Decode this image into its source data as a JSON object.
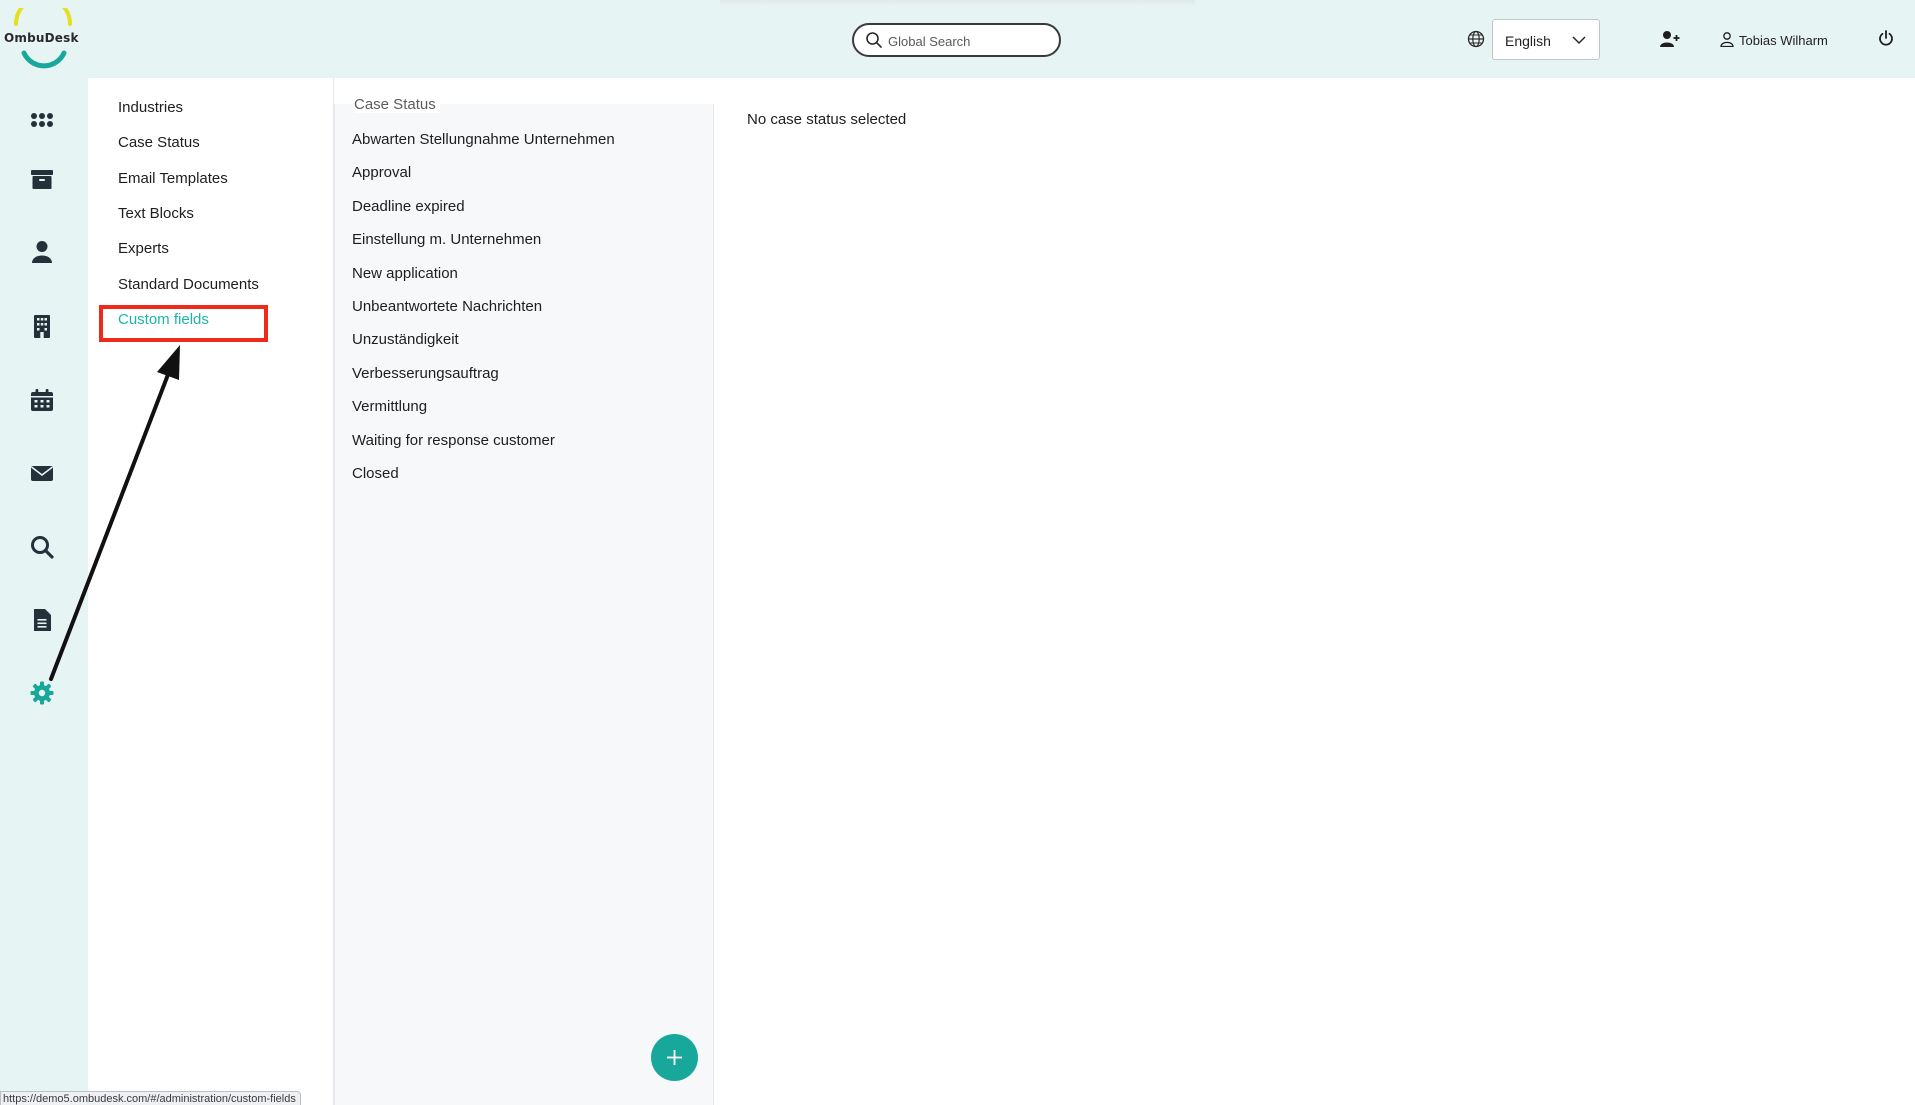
{
  "app": {
    "logo_text": "OmbuDesk"
  },
  "header": {
    "search_placeholder": "Global Search",
    "language": "English",
    "user_name": "Tobias Wilharm"
  },
  "rail": {
    "icons": [
      "apps-grid-icon",
      "archive-icon",
      "person-icon",
      "building-icon",
      "calendar-icon",
      "mail-icon",
      "search-icon",
      "document-icon",
      "settings-icon"
    ],
    "active": "settings-icon"
  },
  "submenu": {
    "items": [
      {
        "label": "Industries"
      },
      {
        "label": "Case Status"
      },
      {
        "label": "Email Templates"
      },
      {
        "label": "Text Blocks"
      },
      {
        "label": "Experts"
      },
      {
        "label": "Standard Documents"
      },
      {
        "label": "Custom fields"
      }
    ],
    "active_index": 6
  },
  "case_status": {
    "title": "Case Status",
    "items": [
      "Abwarten Stellungnahme Unternehmen",
      "Approval",
      "Deadline expired",
      "Einstellung m. Unternehmen",
      "New application",
      "Unbeantwortete Nachrichten",
      "Unzuständigkeit",
      "Verbesserungsauftrag",
      "Vermittlung",
      "Waiting for response customer",
      "Closed"
    ]
  },
  "detail": {
    "empty_message": "No case status selected"
  },
  "status_bar": {
    "url": "https://demo5.ombudesk.com/#/administration/custom-fields"
  },
  "colors": {
    "accent": "#1bb5a8",
    "header_bg": "#e6f4f3",
    "highlight": "#ee2a1b",
    "fab": "#17a89b"
  }
}
